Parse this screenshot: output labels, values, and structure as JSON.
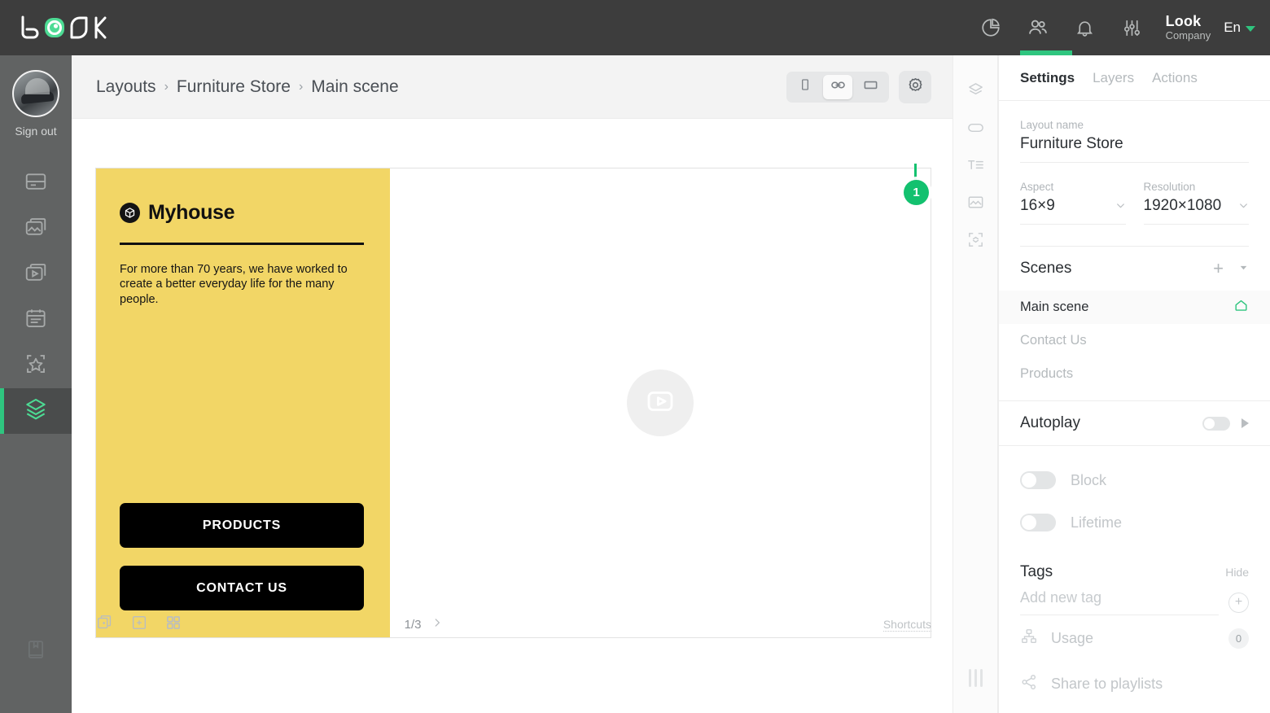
{
  "header": {
    "logo_alt": "LOOK",
    "icons": [
      "pie-chart-icon",
      "users-icon",
      "bell-icon",
      "sliders-icon"
    ],
    "brand_name": "Look",
    "brand_sub": "Company",
    "language": "En"
  },
  "rail": {
    "signout_label": "Sign out",
    "items": [
      {
        "name": "layouts-card-icon"
      },
      {
        "name": "images-icon"
      },
      {
        "name": "videos-icon"
      },
      {
        "name": "schedule-icon"
      },
      {
        "name": "widgets-icon"
      },
      {
        "name": "layers-icon"
      }
    ],
    "bottom_item": {
      "name": "manual-icon"
    }
  },
  "breadcrumb": {
    "items": [
      "Layouts",
      "Furniture Store",
      "Main scene"
    ],
    "separator": "›"
  },
  "viewbar": {
    "segments": [
      {
        "name": "portrait-view-icon",
        "active": false
      },
      {
        "name": "link-view-icon",
        "active": true
      },
      {
        "name": "landscape-view-icon",
        "active": false
      }
    ],
    "settings_icon": "gear-icon",
    "marker_number": "1"
  },
  "canvas": {
    "brand_title": "Myhouse",
    "brand_mark": "cube-icon",
    "body_text": "For more than 70 years, we have worked to create a better everyday life for the many people.",
    "buttons": [
      "PRODUCTS",
      "CONTACT US"
    ],
    "media_placeholder_icon": "video-play-icon",
    "panel_color": "#f2d666",
    "button_color": "#000000"
  },
  "stagebar": {
    "icons": [
      "duplicate-scene-icon",
      "add-scene-icon",
      "grid-view-icon"
    ],
    "page_indicator": "1/3",
    "next_icon": "chevron-right-icon",
    "shortcuts_label": "Shortcuts"
  },
  "toolstrip": {
    "items": [
      {
        "name": "layers-tool-icon"
      },
      {
        "name": "shape-tool-icon"
      },
      {
        "name": "text-tool-icon"
      },
      {
        "name": "image-tool-icon"
      },
      {
        "name": "widget-tool-icon"
      }
    ],
    "collapse_handle": "panel-collapse-handle"
  },
  "right_panel": {
    "tabs": [
      {
        "label": "Settings",
        "active": true
      },
      {
        "label": "Layers",
        "active": false
      },
      {
        "label": "Actions",
        "active": false
      }
    ],
    "layout_name_label": "Layout name",
    "layout_name_value": "Furniture Store",
    "aspect_label": "Aspect",
    "aspect_value": "16×9",
    "resolution_label": "Resolution",
    "resolution_value": "1920×1080",
    "scenes_title": "Scenes",
    "scenes": [
      {
        "label": "Main scene",
        "active": true,
        "home": true
      },
      {
        "label": "Contact Us",
        "active": false,
        "home": false
      },
      {
        "label": "Products",
        "active": false,
        "home": false
      }
    ],
    "autoplay_label": "Autoplay",
    "autoplay_on": false,
    "options": [
      {
        "label": "Block",
        "on": false
      },
      {
        "label": "Lifetime",
        "on": false
      }
    ],
    "tags_title": "Tags",
    "tags_hide_label": "Hide",
    "tag_placeholder": "Add new tag",
    "usage_label": "Usage",
    "usage_count": "0",
    "share_label": "Share to playlists",
    "accent_color": "#2fc57f"
  }
}
